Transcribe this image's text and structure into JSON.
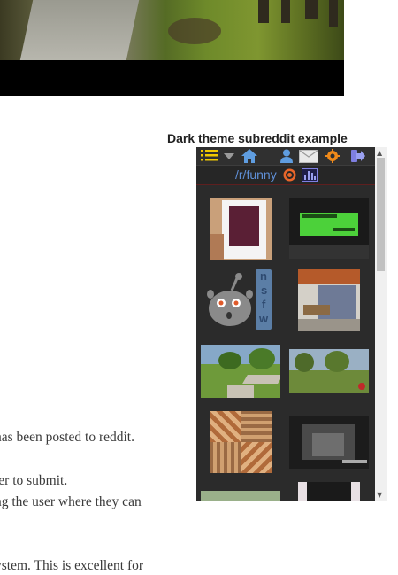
{
  "article": {
    "line1": "has been posted to reddit.",
    "line2": "ter to submit.",
    "line3": "ng the user where they can",
    "line4": "ystem.  This is excellent for"
  },
  "widget": {
    "title": "Dark theme subreddit example",
    "subreddit": "/r/funny",
    "nsfw_letters": [
      "n",
      "s",
      "f",
      "w"
    ],
    "icons": {
      "menu": "list-icon",
      "dropdown": "chevron-down-icon",
      "home": "home-icon",
      "user": "user-icon",
      "mail": "mail-icon",
      "prefs": "gear-icon",
      "logout": "logout-icon",
      "target": "target-icon",
      "stats": "bar-chart-icon"
    },
    "colors": {
      "panel": "#2b2b2b",
      "link": "#5f8fd6",
      "accent": "#f0c800",
      "orange": "#f08a1a"
    },
    "thumbnails": [
      "thumb-photo-frame",
      "thumb-lcd-display",
      "thumb-nsfw-alien",
      "thumb-room",
      "thumb-park-path",
      "thumb-park-trees",
      "thumb-tiles",
      "thumb-dark-street",
      "thumb-partial-1",
      "thumb-partial-2"
    ]
  }
}
